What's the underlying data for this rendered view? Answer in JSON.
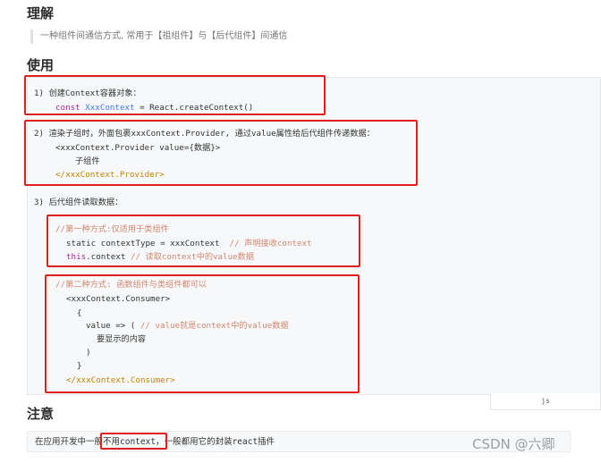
{
  "headings": {
    "understand": "理解",
    "usage": "使用",
    "note": "注意"
  },
  "quote": "一种组件间通信方式, 常用于【祖组件】与【后代组件】间通信",
  "code": {
    "step1_title": "1) 创建Context容器对象：",
    "step1_code_kw": "const",
    "step1_code_var": "XxxContext",
    "step1_code_rest": " = React.createContext()",
    "step2_title": "2) 渲染子组时，外面包裹xxxContext.Provider, 通过value属性给后代组件传递数据：",
    "step2_open_tag": "<xxxContext.Provider value={数据}>",
    "step2_child": "子组件",
    "step2_close_tag": "</xxxContext.Provider>",
    "step3_title": "3) 后代组件读取数据：",
    "way1_comment": "//第一种方式:仅适用于类组件",
    "way1_line1_code": "static contextType = xxxContext",
    "way1_line1_comment": "  // 声明接收context",
    "way1_line2_kw": "this",
    "way1_line2_code": ".context",
    "way1_line2_comment": " // 读取context中的value数据",
    "way2_comment": "//第二种方式: 函数组件与类组件都可以",
    "way2_open": "<xxxContext.Consumer>",
    "way2_brace_open": "{",
    "way2_value_code": "value => ( ",
    "way2_value_comment": "// value就是context中的value数据",
    "way2_content": "要显示的内容",
    "way2_paren_close": ")",
    "way2_brace_close": "}",
    "way2_close": "</xxxContext.Consumer>"
  },
  "code_lang": "js",
  "note": {
    "prefix": "在应用开发中一般",
    "highlight": "不用context，",
    "suffix": "一般都用它的封装react插件"
  },
  "watermark": "CSDN @六卿"
}
